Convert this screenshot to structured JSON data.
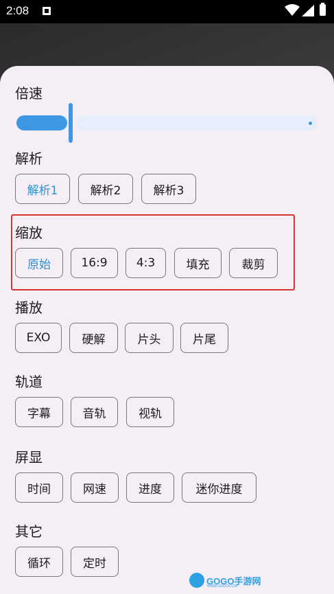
{
  "status_bar": {
    "time": "2:08"
  },
  "panel": {
    "speed": {
      "title": "倍速",
      "level": 0.21
    },
    "parse": {
      "title": "解析",
      "options": [
        "解析1",
        "解析2",
        "解析3"
      ],
      "selected": "解析1"
    },
    "scale": {
      "title": "缩放",
      "options": [
        "原始",
        "16:9",
        "4:3",
        "填充",
        "裁剪"
      ],
      "selected": "原始"
    },
    "play": {
      "title": "播放",
      "options": [
        "EXO",
        "硬解",
        "片头",
        "片尾"
      ]
    },
    "track": {
      "title": "轨道",
      "options": [
        "字幕",
        "音轨",
        "视轨"
      ]
    },
    "display": {
      "title": "屏显",
      "options": [
        "时间",
        "网速",
        "进度",
        "迷你进度"
      ]
    },
    "other": {
      "title": "其它",
      "options": [
        "循环",
        "定时"
      ]
    }
  },
  "watermark": {
    "text": "GOGO手游网",
    "sub": "WWW.GOGOO.CN"
  },
  "colors": {
    "accent": "#2f8fd3",
    "highlight": "#d8332f",
    "panel_bg": "#f5eef5"
  },
  "icons": [
    "notification-icon",
    "wifi-icon",
    "signal-icon",
    "battery-icon"
  ]
}
